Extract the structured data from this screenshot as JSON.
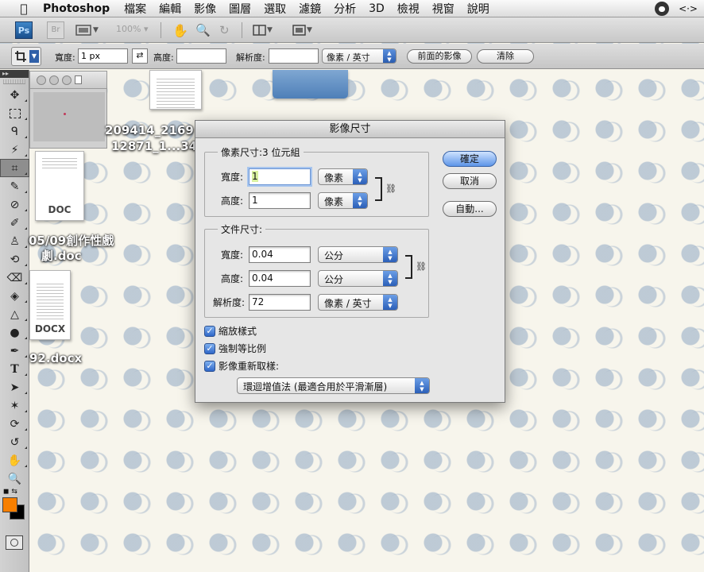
{
  "menubar": {
    "app_name": "Photoshop",
    "items": [
      "檔案",
      "編輯",
      "影像",
      "圖層",
      "選取",
      "濾鏡",
      "分析",
      "3D",
      "檢視",
      "視窗",
      "說明"
    ]
  },
  "appbar": {
    "ps_logo": "Ps",
    "br_logo": "Br",
    "zoom": "100%"
  },
  "options": {
    "width_label": "寬度:",
    "width_value": "1 px",
    "height_label": "高度:",
    "height_value": "",
    "resolution_label": "解析度:",
    "resolution_value": "",
    "unit": "像素 / 英寸",
    "front_image_button": "前面的影像",
    "clear_button": "清除"
  },
  "desktop": {
    "label_1a": "209414_2169",
    "label_1b": "12871_1...34",
    "doc_tag": "DOC",
    "doc_label_a": "05/09創作性戲",
    "doc_label_b": "劇.doc",
    "docx_tag": "DOCX",
    "docx_label": "92.docx"
  },
  "dialog": {
    "title": "影像尺寸",
    "pixel_group_title": "像素尺寸:3 位元組",
    "pixel_width_label": "寬度:",
    "pixel_width_value": "1",
    "pixel_width_unit": "像素",
    "pixel_height_label": "高度:",
    "pixel_height_value": "1",
    "pixel_height_unit": "像素",
    "doc_group_title": "文件尺寸:",
    "doc_width_label": "寬度:",
    "doc_width_value": "0.04",
    "doc_width_unit": "公分",
    "doc_height_label": "高度:",
    "doc_height_value": "0.04",
    "doc_height_unit": "公分",
    "resolution_label": "解析度:",
    "resolution_value": "72",
    "resolution_unit": "像素 / 英寸",
    "ok_button": "確定",
    "cancel_button": "取消",
    "auto_button": "自動...",
    "scale_styles": "縮放樣式",
    "constrain_proportions": "強制等比例",
    "resample_image": "影像重新取樣:",
    "resample_method": "環迴增值法 (最適合用於平滑漸層)"
  },
  "colors": {
    "foreground": "#f77f00",
    "background": "#000000"
  }
}
